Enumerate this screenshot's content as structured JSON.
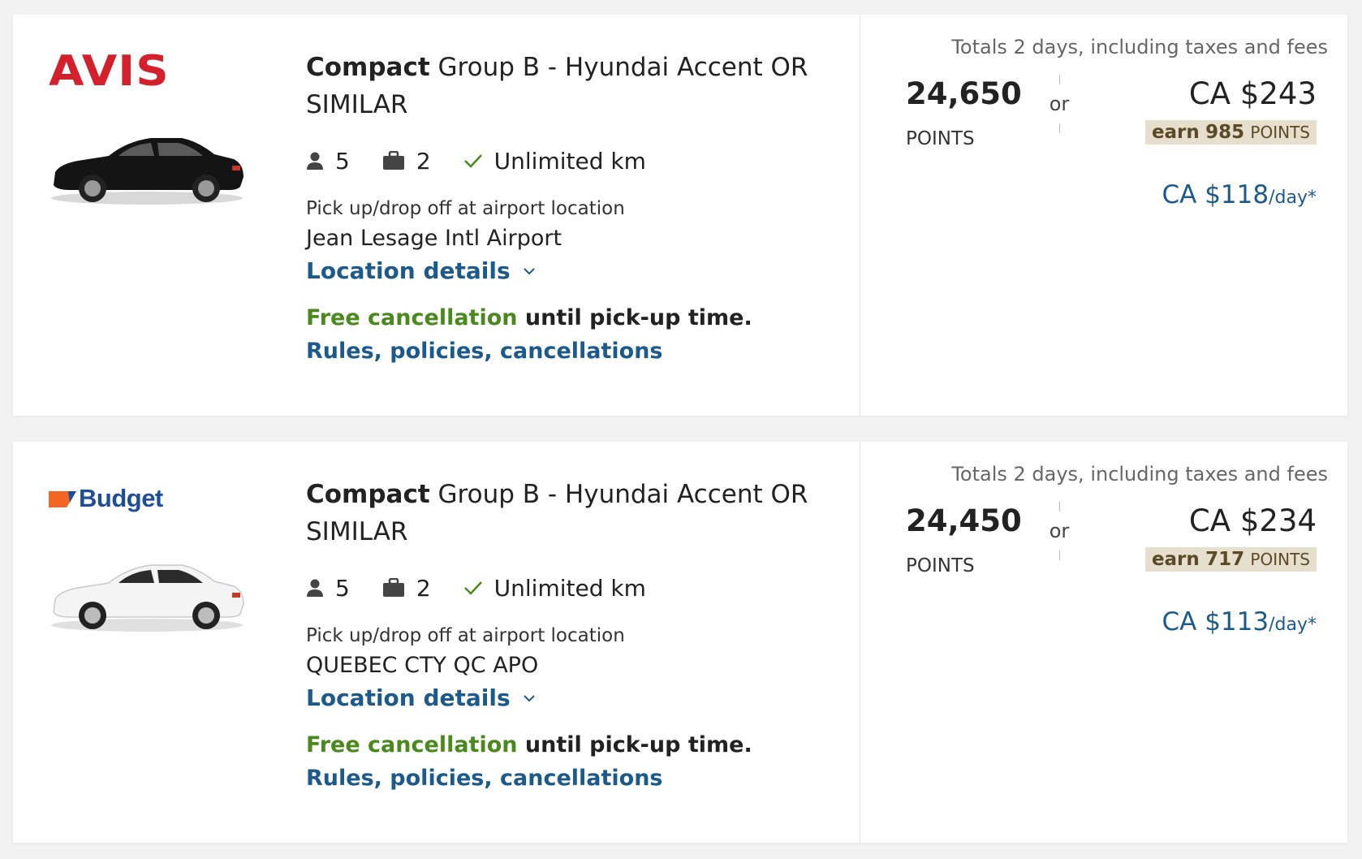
{
  "listings": [
    {
      "brand": "AVIS",
      "car_color": "black",
      "class_name": "Compact",
      "description": "Group B - Hyundai Accent OR SIMILAR",
      "passengers": "5",
      "bags": "2",
      "mileage": "Unlimited km",
      "pickup_label": "Pick up/drop off at airport location",
      "pickup_name": "Jean Lesage Intl Airport",
      "location_details": "Location details",
      "free_cancel": "Free cancellation",
      "cancel_rest": " until pick-up time.",
      "rules_link": "Rules, policies, cancellations",
      "totals_note": "Totals 2 days, including taxes and fees",
      "points": "24,650",
      "points_label": "POINTS",
      "or": "or",
      "price": "CA $243",
      "earn_prefix": "earn",
      "earn_points": "985",
      "earn_suffix": "POINTS",
      "per_day": "CA $118",
      "per_day_unit": "/day*"
    },
    {
      "brand": "Budget",
      "car_color": "white",
      "class_name": "Compact",
      "description": "Group B - Hyundai Accent OR SIMILAR",
      "passengers": "5",
      "bags": "2",
      "mileage": "Unlimited km",
      "pickup_label": "Pick up/drop off at airport location",
      "pickup_name": "QUEBEC CTY QC APO",
      "location_details": "Location details",
      "free_cancel": "Free cancellation",
      "cancel_rest": " until pick-up time.",
      "rules_link": "Rules, policies, cancellations",
      "totals_note": "Totals 2 days, including taxes and fees",
      "points": "24,450",
      "points_label": "POINTS",
      "or": "or",
      "price": "CA $234",
      "earn_prefix": "earn",
      "earn_points": "717",
      "earn_suffix": "POINTS",
      "per_day": "CA $113",
      "per_day_unit": "/day*"
    }
  ],
  "icons": {
    "passengers": "person-icon",
    "bags": "suitcase-icon",
    "mileage": "checkmark-icon",
    "expand": "chevron-down-icon"
  },
  "colors": {
    "link": "#1d5a8c",
    "free": "#4a8a1d",
    "avis": "#d4202c",
    "budget": "#1f4e99",
    "budget_mark": "#f26522",
    "earn_badge": "#e6dfcd"
  }
}
